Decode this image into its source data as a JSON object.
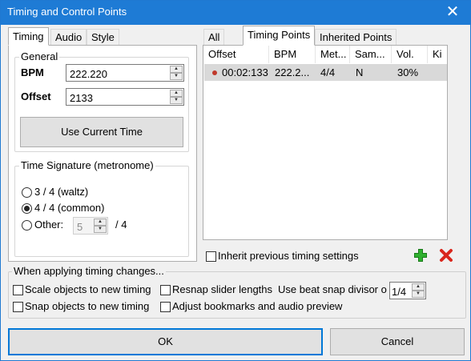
{
  "window": {
    "title": "Timing and Control Points",
    "close_glyph": "✕"
  },
  "left_tabs": [
    "Timing",
    "Audio",
    "Style"
  ],
  "general": {
    "legend": "General",
    "bpm_label": "BPM",
    "bpm_value": "222.220",
    "offset_label": "Offset",
    "offset_value": "2133",
    "use_current_time": "Use Current Time"
  },
  "time_signature": {
    "legend": "Time Signature (metronome)",
    "options": [
      "3 / 4 (waltz)",
      "4 / 4 (common)",
      "Other:"
    ],
    "selected": "4 / 4 (common)",
    "other_value": "5",
    "other_suffix": "/ 4"
  },
  "right_tabs": [
    "All",
    "Timing Points",
    "Inherited Points"
  ],
  "table": {
    "columns": [
      "Offset",
      "BPM",
      "Met...",
      "Sam...",
      "Vol.",
      "Ki"
    ],
    "rows": [
      {
        "offset": "00:02:133",
        "bpm": "222.2...",
        "meter": "4/4",
        "sample": "N",
        "volume": "30%",
        "kiai": ""
      }
    ]
  },
  "inherit_previous": "Inherit previous timing settings",
  "icons": {
    "add": "plus-icon",
    "remove": "cross-icon",
    "add_color": "#2fb02f",
    "remove_color": "#d9261c"
  },
  "applying": {
    "legend": "When applying timing changes...",
    "scale_objects": "Scale objects to new timing",
    "resnap_sliders": "Resnap slider lengths",
    "beat_snap_label": "Use beat snap divisor o",
    "beat_snap_value": "1/4",
    "snap_objects": "Snap objects to new timing",
    "adjust_bookmarks": "Adjust bookmarks and audio preview"
  },
  "buttons": {
    "ok": "OK",
    "cancel": "Cancel"
  },
  "colors": {
    "title_bar": "#1e7bd5",
    "row_highlight": "#d9d9d9",
    "row_marker": "#c0392b"
  }
}
